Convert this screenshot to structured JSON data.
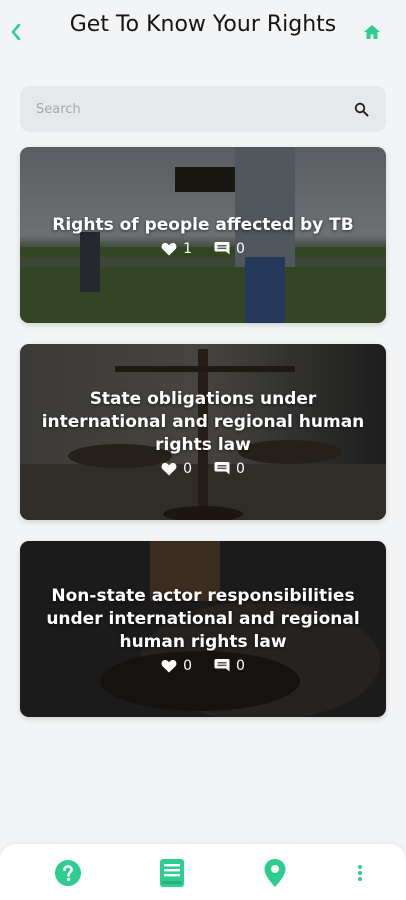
{
  "header": {
    "title": "Get To Know Your Rights",
    "back_icon": "chevron-left-icon",
    "home_icon": "home-icon"
  },
  "search": {
    "placeholder": "Search",
    "value": "",
    "icon": "search-icon"
  },
  "colors": {
    "accent": "#2ecc8f",
    "background": "#f2f4f5"
  },
  "cards": [
    {
      "title": "Rights of people affected by TB",
      "likes": "1",
      "comments": "0"
    },
    {
      "title": "State obligations under international and regional human rights law",
      "likes": "0",
      "comments": "0"
    },
    {
      "title": "Non-state actor responsibilities under international and regional human rights law",
      "likes": "0",
      "comments": "0"
    }
  ],
  "bottom_nav": [
    {
      "icon": "help-circle-icon"
    },
    {
      "icon": "book-icon"
    },
    {
      "icon": "map-pin-icon"
    },
    {
      "icon": "more-vertical-icon"
    }
  ]
}
